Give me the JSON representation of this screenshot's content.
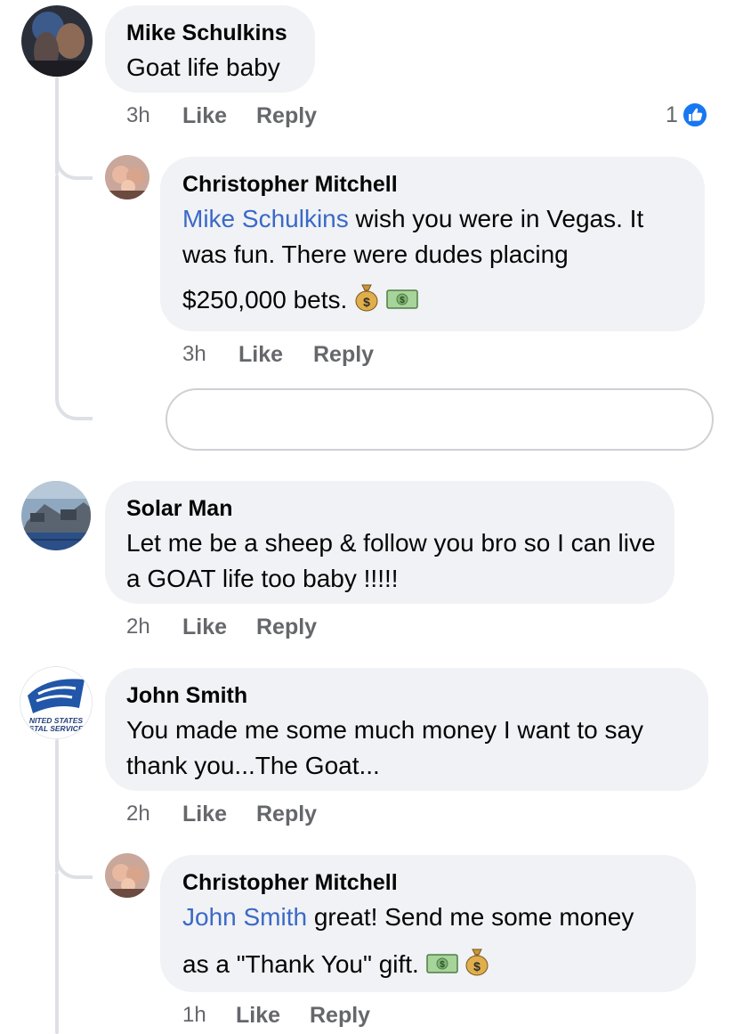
{
  "comments": [
    {
      "author": "Mike Schulkins",
      "text": "Goat life baby",
      "time": "3h",
      "like": "Like",
      "reply": "Reply",
      "reactions": "1"
    },
    {
      "author": "Christopher Mitchell",
      "mention": "Mike Schulkins",
      "text_after_mention": " wish you were in Vegas. It was fun. There were dudes placing",
      "text_line3": "$250,000 bets.",
      "emojis": [
        "money-bag-icon",
        "dollar-banknote-icon"
      ],
      "time": "3h",
      "like": "Like",
      "reply": "Reply"
    },
    {
      "author": "Solar Man",
      "text": "Let me be a sheep & follow you bro so I can live a GOAT life too baby !!!!!",
      "time": "2h",
      "like": "Like",
      "reply": "Reply"
    },
    {
      "author": "John Smith",
      "text": "You made me some much money I want to say thank you...The Goat...",
      "time": "2h",
      "like": "Like",
      "reply": "Reply",
      "avatar_text": "NITED STATES\nSTAL SERVICE"
    },
    {
      "author": "Christopher Mitchell",
      "mention": "John Smith",
      "text_after_mention": " great! Send me some money",
      "text_line2": "as a \"Thank You\" gift.",
      "emojis": [
        "dollar-banknote-icon",
        "money-bag-icon"
      ],
      "time": "1h",
      "like": "Like",
      "reply": "Reply"
    }
  ],
  "reply_input": {
    "value": ""
  },
  "colors": {
    "bubble": "#f0f2f5",
    "meta": "#65676b",
    "mention": "#3b69c6",
    "like_badge": "#1877f2"
  }
}
